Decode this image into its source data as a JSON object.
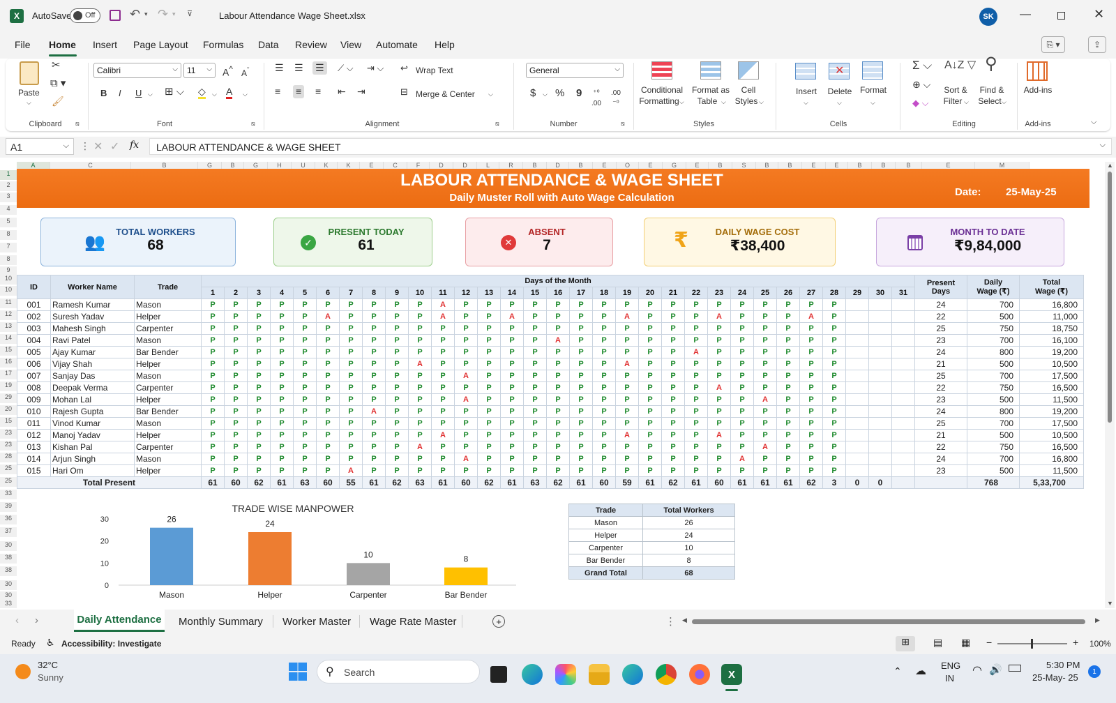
{
  "window": {
    "autosave_label": "AutoSave",
    "autosave_state": "Off",
    "file_name": "Labour Attendance Wage Sheet.xlsx",
    "user_initials": "SK"
  },
  "menu": [
    "File",
    "Home",
    "Insert",
    "Page Layout",
    "Formulas",
    "Data",
    "Review",
    "View",
    "Automate",
    "Help"
  ],
  "ribbon": {
    "clipboard": {
      "paste": "Paste",
      "label": "Clipboard"
    },
    "font": {
      "name": "Calibri",
      "size": "11",
      "bold": "B",
      "italic": "I",
      "underline": "U",
      "label": "Font"
    },
    "alignment": {
      "wrap": "Wrap Text",
      "merge": "Merge & Center",
      "label": "Alignment"
    },
    "number": {
      "format": "General",
      "currency": "$",
      "percent": "%",
      "comma": "9",
      "label": "Number"
    },
    "styles": {
      "cond": [
        "Conditional",
        "Formatting"
      ],
      "table": [
        "Format as",
        "Table"
      ],
      "cell": [
        "Cell",
        "Styles"
      ],
      "label": "Styles"
    },
    "cells": {
      "insert": "Insert",
      "delete": "Delete",
      "format": "Format",
      "label": "Cells"
    },
    "editing": {
      "sort": [
        "Sort &",
        "Filter"
      ],
      "find": [
        "Find &",
        "Select"
      ],
      "label": "Editing"
    },
    "addins": {
      "btn": "Add-ins",
      "label": "Add-ins"
    }
  },
  "formula_bar": {
    "name_box": "A1",
    "fx": "fx",
    "content": "LABOUR ATTENDANCE & WAGE SHEET"
  },
  "columns": [
    "A",
    "C",
    "B",
    "G",
    "B",
    "G",
    "H",
    "U",
    "K",
    "K",
    "E",
    "C",
    "F",
    "D",
    "D",
    "L",
    "R",
    "B",
    "D",
    "B",
    "E",
    "O",
    "E",
    "G",
    "E",
    "B",
    "S",
    "B",
    "B",
    "E",
    "E",
    "B",
    "B",
    "B",
    "E",
    "M"
  ],
  "rows": [
    "1",
    "2",
    "3",
    "4",
    "5",
    "8",
    "7",
    "8",
    "9",
    "10",
    "10",
    "11",
    "12",
    "13",
    "14",
    "15",
    "16",
    "17",
    "19",
    "29",
    "20",
    "15",
    "23",
    "23",
    "28",
    "25",
    "25",
    "33",
    "39",
    "36",
    "37",
    "30",
    "38",
    "38",
    "30",
    "30",
    "33"
  ],
  "sheet": {
    "title": "LABOUR ATTENDANCE & WAGE SHEET",
    "subtitle": "Daily Muster Roll with Auto Wage Calculation",
    "date_label": "Date:",
    "date_value": "25-May-25"
  },
  "cards": [
    {
      "label": "TOTAL WORKERS",
      "value": "68"
    },
    {
      "label": "PRESENT TODAY",
      "value": "61"
    },
    {
      "label": "ABSENT",
      "value": "7"
    },
    {
      "label": "DAILY WAGE COST",
      "value": "₹38,400"
    },
    {
      "label": "MONTH TO DATE",
      "value": "₹9,84,000"
    }
  ],
  "table": {
    "headers": {
      "id": "ID",
      "name": "Worker Name",
      "trade": "Trade",
      "days": "Days of the Month",
      "present": [
        "Present",
        "Days"
      ],
      "wage": [
        "Daily",
        "Wage (₹)"
      ],
      "total": [
        "Total",
        "Wage (₹)"
      ]
    },
    "day_numbers": [
      "1",
      "2",
      "3",
      "4",
      "5",
      "6",
      "7",
      "8",
      "9",
      "10",
      "11",
      "12",
      "13",
      "14",
      "15",
      "16",
      "17",
      "18",
      "19",
      "20",
      "21",
      "22",
      "23",
      "24",
      "25",
      "26",
      "27",
      "28",
      "29",
      "30",
      "31"
    ],
    "workers": [
      {
        "id": "001",
        "name": "Ramesh Kumar",
        "trade": "Mason",
        "att": "PPPPPPPPPPAPPPPPPPPPPPPPPPPP",
        "present": "24",
        "wage": "700",
        "total": "16,800"
      },
      {
        "id": "002",
        "name": "Suresh Yadav",
        "trade": "Helper",
        "att": "PPPPPAPPPPAPPAPPPPAPPPAPPPAP",
        "present": "22",
        "wage": "500",
        "total": "11,000"
      },
      {
        "id": "003",
        "name": "Mahesh Singh",
        "trade": "Carpenter",
        "att": "PPPPPPPPPPPPPPPPPPPPPPPPPPPP",
        "present": "25",
        "wage": "750",
        "total": "18,750"
      },
      {
        "id": "004",
        "name": "Ravi Patel",
        "trade": "Mason",
        "att": "PPPPPPPPPPPPPPPAPPPPPPPPPPPP",
        "present": "23",
        "wage": "700",
        "total": "16,100"
      },
      {
        "id": "005",
        "name": "Ajay Kumar",
        "trade": "Bar Bender",
        "att": "PPPPPPPPPPPPPPPPPPPPPAPPPPPP",
        "present": "24",
        "wage": "800",
        "total": "19,200"
      },
      {
        "id": "006",
        "name": "Vijay Shah",
        "trade": "Helper",
        "att": "PPPPPPPPPAPPPPPPPPAPPPPPPPPP",
        "present": "21",
        "wage": "500",
        "total": "10,500"
      },
      {
        "id": "007",
        "name": "Sanjay Das",
        "trade": "Mason",
        "att": "PPPPPPPPPPPAPPPPPPPPPPPPPPPP",
        "present": "25",
        "wage": "700",
        "total": "17,500"
      },
      {
        "id": "008",
        "name": "Deepak Verma",
        "trade": "Carpenter",
        "att": "PPPPPPPPPPPPPPPPPPPPPPAPPPPP",
        "present": "22",
        "wage": "750",
        "total": "16,500"
      },
      {
        "id": "009",
        "name": "Mohan Lal",
        "trade": "Helper",
        "att": "PPPPPPPPPPPAPPPPPPPPPPPPAPPP",
        "present": "23",
        "wage": "500",
        "total": "11,500"
      },
      {
        "id": "010",
        "name": "Rajesh Gupta",
        "trade": "Bar Bender",
        "att": "PPPPPPPAPPPPPPPPPPPPPPPPPPPP",
        "present": "24",
        "wage": "800",
        "total": "19,200"
      },
      {
        "id": "011",
        "name": "Vinod Kumar",
        "trade": "Mason",
        "att": "PPPPPPPPPPPPPPPPPPPPPPPPPPPP",
        "present": "25",
        "wage": "700",
        "total": "17,500"
      },
      {
        "id": "012",
        "name": "Manoj Yadav",
        "trade": "Helper",
        "att": "PPPPPPPPPPAPPPPPPPAPPPAPPPPP",
        "present": "21",
        "wage": "500",
        "total": "10,500"
      },
      {
        "id": "013",
        "name": "Kishan Pal",
        "trade": "Carpenter",
        "att": "PPPPPPPPPAPPPPPPPPPPPPPPAPPP",
        "present": "22",
        "wage": "750",
        "total": "16,500"
      },
      {
        "id": "014",
        "name": "Arjun Singh",
        "trade": "Mason",
        "att": "PPPPPPPPPPPAPPPPPPPPPPPAPPPP",
        "present": "24",
        "wage": "700",
        "total": "16,800"
      },
      {
        "id": "015",
        "name": "Hari Om",
        "trade": "Helper",
        "att": "PPPPPPAPPPPPPPPPPPPPPPPPPPPP",
        "present": "23",
        "wage": "500",
        "total": "11,500"
      }
    ],
    "total_label": "Total Present",
    "day_totals": [
      "61",
      "60",
      "62",
      "61",
      "63",
      "60",
      "55",
      "61",
      "62",
      "63",
      "61",
      "60",
      "62",
      "61",
      "63",
      "62",
      "61",
      "60",
      "59",
      "61",
      "62",
      "61",
      "60",
      "61",
      "61",
      "61",
      "62",
      "3",
      "0",
      "0"
    ],
    "total_present": "768",
    "total_wage": "5,33,700"
  },
  "chart_data": {
    "type": "bar",
    "title": "TRADE WISE MANPOWER",
    "categories": [
      "Mason",
      "Helper",
      "Carpenter",
      "Bar Bender"
    ],
    "values": [
      26,
      24,
      10,
      8
    ],
    "colors": [
      "#5b9bd5",
      "#ed7d31",
      "#a5a5a5",
      "#ffc000"
    ],
    "yticks": [
      "30",
      "20",
      "10",
      "0"
    ],
    "ylim": [
      0,
      30
    ],
    "legend": "none",
    "grid": false
  },
  "trade_table": {
    "headers": [
      "Trade",
      "Total Workers"
    ],
    "rows": [
      [
        "Mason",
        "26"
      ],
      [
        "Helper",
        "24"
      ],
      [
        "Carpenter",
        "10"
      ],
      [
        "Bar Bender",
        "8"
      ]
    ],
    "total": [
      "Grand Total",
      "68"
    ]
  },
  "sheet_tabs": [
    "Daily Attendance",
    "Monthly Summary",
    "Worker Master",
    "Wage Rate Master"
  ],
  "status": {
    "ready": "Ready",
    "accessibility": "Accessibility: Investigate",
    "zoom": "100%"
  },
  "taskbar": {
    "temp": "32°C",
    "weather": "Sunny",
    "search": "Search",
    "lang": [
      "ENG",
      "IN"
    ],
    "time": "5:30 PM",
    "date": "25-May- 25",
    "notif": "1"
  },
  "colors": {
    "excel_green": "#1d6f42",
    "banner_orange": "#ef7120",
    "present_green": "#1d8a2c",
    "absent_red": "#e03030"
  }
}
